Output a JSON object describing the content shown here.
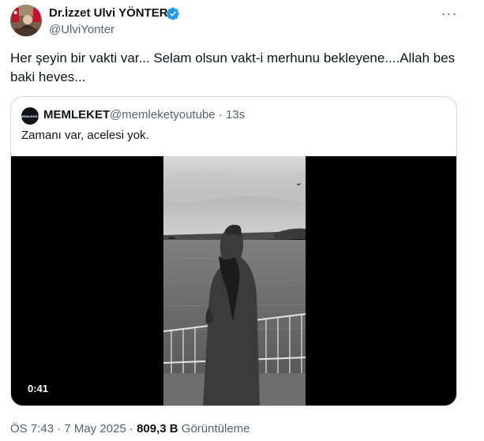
{
  "author": {
    "name": "Dr.İzzet Ulvi YÖNTER",
    "handle": "@UlviYonter"
  },
  "tweet": {
    "text": "Her şeyin bir vakti var... Selam olsun vakt-i merhunu bekleyene....Allah bes baki heves..."
  },
  "more_label": "···",
  "quote": {
    "avatar_text": "MEMLEKET",
    "name": "MEMLEKET",
    "meta": "@memleketyoutube · 13s",
    "text": "Zamanı var, acelesi yok.",
    "video_duration": "0:41"
  },
  "footer": {
    "time_date": "ÖS 7:43 · 7 May 2025 · ",
    "views_count": "809,3 B",
    "views_label": " Görüntüleme"
  },
  "colors": {
    "verified": "#1d9bf0",
    "secondary_text": "#536471",
    "primary_text": "#0f1419",
    "border": "#cfd9de"
  },
  "icons": [
    "verified-badge-icon",
    "more-options-icon"
  ]
}
